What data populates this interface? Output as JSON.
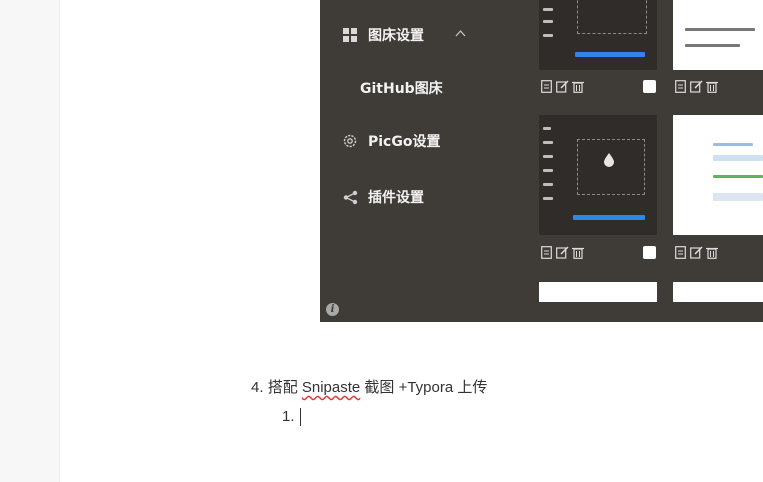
{
  "screenshot": {
    "menu": {
      "image_host_settings": "图床设置",
      "github_host": "GitHub图床",
      "picgo_settings": "PicGo设置",
      "plugin_settings": "插件设置"
    },
    "icons": {
      "grid": "grid-icon",
      "gear": "gear-icon",
      "share": "share-icon",
      "info": "info-icon",
      "chevron": "chevron-up-icon",
      "file": "file-icon",
      "edit": "edit-icon",
      "trash": "trash-icon"
    }
  },
  "document": {
    "list_item_4": {
      "number": "4.",
      "text_before": "搭配 ",
      "link_word": "Snipaste",
      "text_after": " 截图 +Typora 上传"
    },
    "sub_item_1": {
      "number": "1."
    }
  },
  "colors": {
    "panel_bg": "#3f3b37",
    "accent_blue": "#2f86e8"
  }
}
